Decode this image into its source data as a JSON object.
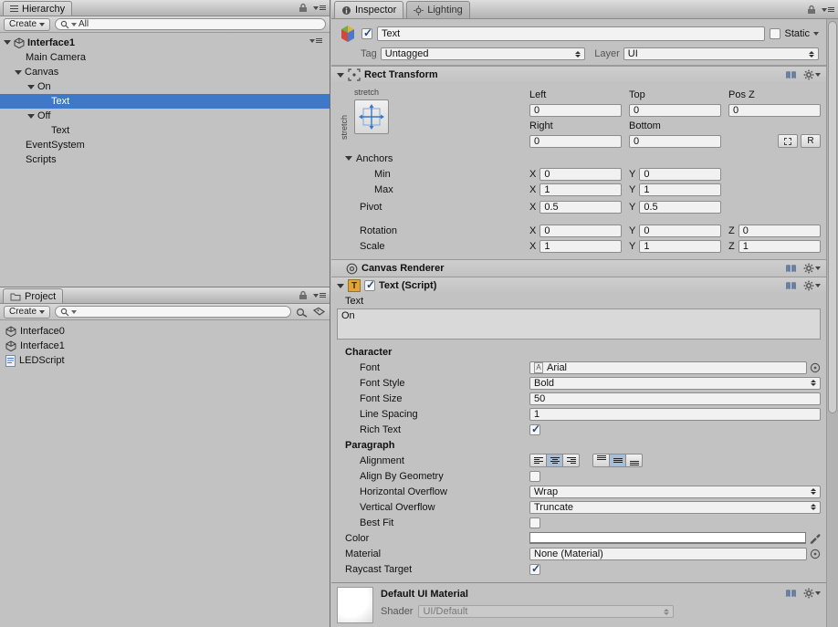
{
  "hierarchy": {
    "tab": "Hierarchy",
    "create": "Create",
    "search_filter": "All",
    "scene": "Interface1",
    "items": [
      {
        "label": "Main Camera"
      },
      {
        "label": "Canvas"
      },
      {
        "label": "On"
      },
      {
        "label": "Text"
      },
      {
        "label": "Off"
      },
      {
        "label": "Text"
      },
      {
        "label": "EventSystem"
      },
      {
        "label": "Scripts"
      }
    ]
  },
  "project": {
    "tab": "Project",
    "create": "Create",
    "items": [
      {
        "label": "Interface0"
      },
      {
        "label": "Interface1"
      },
      {
        "label": "LEDScript"
      }
    ]
  },
  "inspector": {
    "tab": "Inspector",
    "tab_lighting": "Lighting",
    "go": {
      "name": "Text",
      "static": "Static",
      "tag_label": "Tag",
      "tag": "Untagged",
      "layer_label": "Layer",
      "layer": "UI"
    },
    "axis": {
      "x": "X",
      "y": "Y",
      "z": "Z"
    },
    "rect": {
      "title": "Rect Transform",
      "stretch_h": "stretch",
      "stretch_v": "stretch",
      "left_label": "Left",
      "top_label": "Top",
      "posz_label": "Pos Z",
      "left": "0",
      "top": "0",
      "posz": "0",
      "right_label": "Right",
      "bottom_label": "Bottom",
      "right": "0",
      "bottom": "0",
      "r_button": "R",
      "anchors": "Anchors",
      "min_label": "Min",
      "min_x": "0",
      "min_y": "0",
      "max_label": "Max",
      "max_x": "1",
      "max_y": "1",
      "pivot_label": "Pivot",
      "pivot_x": "0.5",
      "pivot_y": "0.5",
      "rotation_label": "Rotation",
      "rot_x": "0",
      "rot_y": "0",
      "rot_z": "0",
      "scale_label": "Scale",
      "scale_x": "1",
      "scale_y": "1",
      "scale_z": "1"
    },
    "canvas_renderer": {
      "title": "Canvas Renderer"
    },
    "text": {
      "title": "Text (Script)",
      "text_label": "Text",
      "value": "On",
      "character": "Character",
      "font_label": "Font",
      "font": "Arial",
      "font_style_label": "Font Style",
      "font_style": "Bold",
      "font_size_label": "Font Size",
      "font_size": "50",
      "line_spacing_label": "Line Spacing",
      "line_spacing": "1",
      "rich_text_label": "Rich Text",
      "paragraph": "Paragraph",
      "alignment_label": "Alignment",
      "align_by_geometry_label": "Align By Geometry",
      "h_overflow_label": "Horizontal Overflow",
      "h_overflow": "Wrap",
      "v_overflow_label": "Vertical Overflow",
      "v_overflow": "Truncate",
      "best_fit_label": "Best Fit",
      "color_label": "Color",
      "material_label": "Material",
      "material": "None (Material)",
      "raycast_label": "Raycast Target"
    },
    "preview": {
      "title": "Default UI Material",
      "shader_label": "Shader",
      "shader": "UI/Default"
    }
  },
  "icons": {
    "font_asset_glyph": "A"
  },
  "colors": {
    "selection": "#3e78c8",
    "check": "#24477d",
    "text_icon_bg": "#e2a33c"
  }
}
